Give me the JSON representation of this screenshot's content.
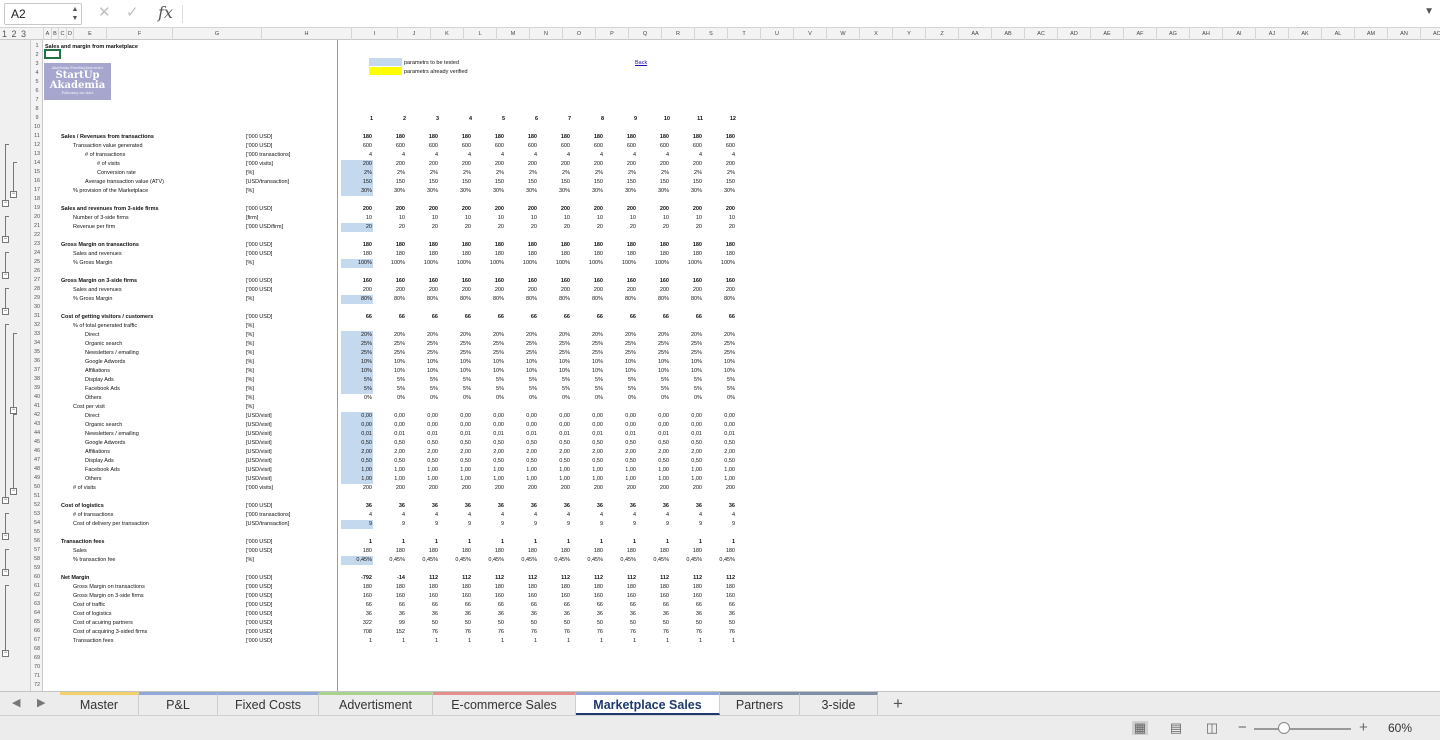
{
  "formula_bar": {
    "name_box": "A2",
    "fx_label": "fx",
    "formula": ""
  },
  "outline_levels": "1 2 3",
  "columns": [
    "A",
    "B",
    "C",
    "D",
    "E",
    "F",
    "G",
    "H",
    "I",
    "J",
    "K",
    "L",
    "M",
    "N",
    "O",
    "P",
    "Q",
    "R",
    "S",
    "T",
    "U",
    "V",
    "W",
    "X",
    "Y",
    "Z",
    "AA",
    "AB",
    "AC",
    "AD",
    "AE",
    "AF",
    "AG",
    "AH",
    "AI",
    "AJ",
    "AK",
    "AL",
    "AM",
    "AN",
    "AO"
  ],
  "sheet": {
    "title": "Sales and margin from marketplace",
    "logo_small_top": "Akademia Przedsiębiorczości",
    "logo_line1": "StartUp",
    "logo_line2": "Akademia",
    "logo_small_bottom": "Polecamy na start",
    "legend_tested": "parametrs to be tested",
    "legend_verified": "parametrs already verified",
    "back_link": "Back",
    "periods": [
      "1",
      "2",
      "3",
      "4",
      "5",
      "6",
      "7",
      "8",
      "9",
      "10",
      "11",
      "12"
    ]
  },
  "rows": [
    {
      "r": 11,
      "label": "Sales / Revenues from transactions",
      "indent": 0,
      "bold": true,
      "unit": "['000 USD]",
      "v": [
        "180",
        "180",
        "180",
        "180",
        "180",
        "180",
        "180",
        "180",
        "180",
        "180",
        "180",
        "180"
      ]
    },
    {
      "r": 12,
      "label": "Transaction value generated",
      "indent": 1,
      "unit": "['000 USD]",
      "v": [
        "600",
        "600",
        "600",
        "600",
        "600",
        "600",
        "600",
        "600",
        "600",
        "600",
        "600",
        "600"
      ]
    },
    {
      "r": 13,
      "label": "# of transactions",
      "indent": 2,
      "unit": "['000 transactions]",
      "v": [
        "4",
        "4",
        "4",
        "4",
        "4",
        "4",
        "4",
        "4",
        "4",
        "4",
        "4",
        "4"
      ]
    },
    {
      "r": 14,
      "label": "# of visits",
      "indent": 3,
      "unit": "['000 visits]",
      "hl": true,
      "v": [
        "200",
        "200",
        "200",
        "200",
        "200",
        "200",
        "200",
        "200",
        "200",
        "200",
        "200",
        "200"
      ]
    },
    {
      "r": 15,
      "label": "Conversion rate",
      "indent": 3,
      "unit": "[%]",
      "hl": true,
      "v": [
        "2%",
        "2%",
        "2%",
        "2%",
        "2%",
        "2%",
        "2%",
        "2%",
        "2%",
        "2%",
        "2%",
        "2%"
      ]
    },
    {
      "r": 16,
      "label": "Average transaction value (ATV)",
      "indent": 2,
      "unit": "[USD/transaction]",
      "hl": true,
      "v": [
        "150",
        "150",
        "150",
        "150",
        "150",
        "150",
        "150",
        "150",
        "150",
        "150",
        "150",
        "150"
      ]
    },
    {
      "r": 17,
      "label": "% provision of the Marketplace",
      "indent": 1,
      "unit": "[%]",
      "hl": true,
      "v": [
        "30%",
        "30%",
        "30%",
        "30%",
        "30%",
        "30%",
        "30%",
        "30%",
        "30%",
        "30%",
        "30%",
        "30%"
      ]
    },
    {
      "r": 19,
      "label": "Sales and revenues from 3-side firms",
      "indent": 0,
      "bold": true,
      "unit": "['000 USD]",
      "v": [
        "200",
        "200",
        "200",
        "200",
        "200",
        "200",
        "200",
        "200",
        "200",
        "200",
        "200",
        "200"
      ]
    },
    {
      "r": 20,
      "label": "Number of 3-side firms",
      "indent": 1,
      "unit": "[firm]",
      "v": [
        "10",
        "10",
        "10",
        "10",
        "10",
        "10",
        "10",
        "10",
        "10",
        "10",
        "10",
        "10"
      ]
    },
    {
      "r": 21,
      "label": "Revenue per firm",
      "indent": 1,
      "unit": "['000 USD/firm]",
      "hl": true,
      "v": [
        "20",
        "20",
        "20",
        "20",
        "20",
        "20",
        "20",
        "20",
        "20",
        "20",
        "20",
        "20"
      ]
    },
    {
      "r": 23,
      "label": "Gross Margin on transactions",
      "indent": 0,
      "bold": true,
      "unit": "['000 USD]",
      "v": [
        "180",
        "180",
        "180",
        "180",
        "180",
        "180",
        "180",
        "180",
        "180",
        "180",
        "180",
        "180"
      ]
    },
    {
      "r": 24,
      "label": "Sales and revenues",
      "indent": 1,
      "unit": "['000 USD]",
      "v": [
        "180",
        "180",
        "180",
        "180",
        "180",
        "180",
        "180",
        "180",
        "180",
        "180",
        "180",
        "180"
      ]
    },
    {
      "r": 25,
      "label": "% Gross Margin",
      "indent": 1,
      "unit": "[%]",
      "hl": true,
      "v": [
        "100%",
        "100%",
        "100%",
        "100%",
        "100%",
        "100%",
        "100%",
        "100%",
        "100%",
        "100%",
        "100%",
        "100%"
      ]
    },
    {
      "r": 27,
      "label": "Gross Margin on 3-side firms",
      "indent": 0,
      "bold": true,
      "unit": "['000 USD]",
      "v": [
        "160",
        "160",
        "160",
        "160",
        "160",
        "160",
        "160",
        "160",
        "160",
        "160",
        "160",
        "160"
      ]
    },
    {
      "r": 28,
      "label": "Sales and revenues",
      "indent": 1,
      "unit": "['000 USD]",
      "v": [
        "200",
        "200",
        "200",
        "200",
        "200",
        "200",
        "200",
        "200",
        "200",
        "200",
        "200",
        "200"
      ]
    },
    {
      "r": 29,
      "label": "% Gross Margin",
      "indent": 1,
      "unit": "[%]",
      "hl": true,
      "v": [
        "80%",
        "80%",
        "80%",
        "80%",
        "80%",
        "80%",
        "80%",
        "80%",
        "80%",
        "80%",
        "80%",
        "80%"
      ]
    },
    {
      "r": 31,
      "label": "Cost of getting visitors / customers",
      "indent": 0,
      "bold": true,
      "unit": "['000 USD]",
      "v": [
        "66",
        "66",
        "66",
        "66",
        "66",
        "66",
        "66",
        "66",
        "66",
        "66",
        "66",
        "66"
      ]
    },
    {
      "r": 32,
      "label": "% of total generated traffic",
      "indent": 1,
      "unit": "[%]",
      "v": [
        "",
        "",
        "",
        "",
        "",
        "",
        "",
        "",
        "",
        "",
        "",
        ""
      ]
    },
    {
      "r": 33,
      "label": "Direct",
      "indent": 2,
      "unit": "[%]",
      "hl": true,
      "v": [
        "20%",
        "20%",
        "20%",
        "20%",
        "20%",
        "20%",
        "20%",
        "20%",
        "20%",
        "20%",
        "20%",
        "20%"
      ]
    },
    {
      "r": 34,
      "label": "Organic search",
      "indent": 2,
      "unit": "[%]",
      "hl": true,
      "v": [
        "25%",
        "25%",
        "25%",
        "25%",
        "25%",
        "25%",
        "25%",
        "25%",
        "25%",
        "25%",
        "25%",
        "25%"
      ]
    },
    {
      "r": 35,
      "label": "Newsletters / emailing",
      "indent": 2,
      "unit": "[%]",
      "hl": true,
      "v": [
        "25%",
        "25%",
        "25%",
        "25%",
        "25%",
        "25%",
        "25%",
        "25%",
        "25%",
        "25%",
        "25%",
        "25%"
      ]
    },
    {
      "r": 36,
      "label": "Google Adwords",
      "indent": 2,
      "unit": "[%]",
      "hl": true,
      "v": [
        "10%",
        "10%",
        "10%",
        "10%",
        "10%",
        "10%",
        "10%",
        "10%",
        "10%",
        "10%",
        "10%",
        "10%"
      ]
    },
    {
      "r": 37,
      "label": "Affiliations",
      "indent": 2,
      "unit": "[%]",
      "hl": true,
      "v": [
        "10%",
        "10%",
        "10%",
        "10%",
        "10%",
        "10%",
        "10%",
        "10%",
        "10%",
        "10%",
        "10%",
        "10%"
      ]
    },
    {
      "r": 38,
      "label": "Display Ads",
      "indent": 2,
      "unit": "[%]",
      "hl": true,
      "v": [
        "5%",
        "5%",
        "5%",
        "5%",
        "5%",
        "5%",
        "5%",
        "5%",
        "5%",
        "5%",
        "5%",
        "5%"
      ]
    },
    {
      "r": 39,
      "label": "Facebook Ads",
      "indent": 2,
      "unit": "[%]",
      "hl": true,
      "v": [
        "5%",
        "5%",
        "5%",
        "5%",
        "5%",
        "5%",
        "5%",
        "5%",
        "5%",
        "5%",
        "5%",
        "5%"
      ]
    },
    {
      "r": 40,
      "label": "Others",
      "indent": 2,
      "unit": "[%]",
      "v": [
        "0%",
        "0%",
        "0%",
        "0%",
        "0%",
        "0%",
        "0%",
        "0%",
        "0%",
        "0%",
        "0%",
        "0%"
      ]
    },
    {
      "r": 41,
      "label": "Cost per visit",
      "indent": 1,
      "unit": "[%]",
      "v": [
        "",
        "",
        "",
        "",
        "",
        "",
        "",
        "",
        "",
        "",
        "",
        ""
      ]
    },
    {
      "r": 42,
      "label": "Direct",
      "indent": 2,
      "unit": "[USD/visit]",
      "hl": true,
      "v": [
        "0,00",
        "0,00",
        "0,00",
        "0,00",
        "0,00",
        "0,00",
        "0,00",
        "0,00",
        "0,00",
        "0,00",
        "0,00",
        "0,00"
      ]
    },
    {
      "r": 43,
      "label": "Organic search",
      "indent": 2,
      "unit": "[USD/visit]",
      "hl": true,
      "v": [
        "0,00",
        "0,00",
        "0,00",
        "0,00",
        "0,00",
        "0,00",
        "0,00",
        "0,00",
        "0,00",
        "0,00",
        "0,00",
        "0,00"
      ]
    },
    {
      "r": 44,
      "label": "Newsletters / emailing",
      "indent": 2,
      "unit": "[USD/visit]",
      "hl": true,
      "v": [
        "0,01",
        "0,01",
        "0,01",
        "0,01",
        "0,01",
        "0,01",
        "0,01",
        "0,01",
        "0,01",
        "0,01",
        "0,01",
        "0,01"
      ]
    },
    {
      "r": 45,
      "label": "Google Adwords",
      "indent": 2,
      "unit": "[USD/visit]",
      "hl": true,
      "v": [
        "0,50",
        "0,50",
        "0,50",
        "0,50",
        "0,50",
        "0,50",
        "0,50",
        "0,50",
        "0,50",
        "0,50",
        "0,50",
        "0,50"
      ]
    },
    {
      "r": 46,
      "label": "Affiliations",
      "indent": 2,
      "unit": "[USD/visit]",
      "hl": true,
      "v": [
        "2,00",
        "2,00",
        "2,00",
        "2,00",
        "2,00",
        "2,00",
        "2,00",
        "2,00",
        "2,00",
        "2,00",
        "2,00",
        "2,00"
      ]
    },
    {
      "r": 47,
      "label": "Display Ads",
      "indent": 2,
      "unit": "[USD/visit]",
      "hl": true,
      "v": [
        "0,50",
        "0,50",
        "0,50",
        "0,50",
        "0,50",
        "0,50",
        "0,50",
        "0,50",
        "0,50",
        "0,50",
        "0,50",
        "0,50"
      ]
    },
    {
      "r": 48,
      "label": "Facebook Ads",
      "indent": 2,
      "unit": "[USD/visit]",
      "hl": true,
      "v": [
        "1,00",
        "1,00",
        "1,00",
        "1,00",
        "1,00",
        "1,00",
        "1,00",
        "1,00",
        "1,00",
        "1,00",
        "1,00",
        "1,00"
      ]
    },
    {
      "r": 49,
      "label": "Others",
      "indent": 2,
      "unit": "[USD/visit]",
      "hl": true,
      "v": [
        "1,00",
        "1,00",
        "1,00",
        "1,00",
        "1,00",
        "1,00",
        "1,00",
        "1,00",
        "1,00",
        "1,00",
        "1,00",
        "1,00"
      ]
    },
    {
      "r": 50,
      "label": "# of visits",
      "indent": 1,
      "unit": "['000 visits]",
      "v": [
        "200",
        "200",
        "200",
        "200",
        "200",
        "200",
        "200",
        "200",
        "200",
        "200",
        "200",
        "200"
      ]
    },
    {
      "r": 52,
      "label": "Cost of logistics",
      "indent": 0,
      "bold": true,
      "unit": "['000 USD]",
      "v": [
        "36",
        "36",
        "36",
        "36",
        "36",
        "36",
        "36",
        "36",
        "36",
        "36",
        "36",
        "36"
      ]
    },
    {
      "r": 53,
      "label": "# of transactions",
      "indent": 1,
      "unit": "['000 transactions]",
      "v": [
        "4",
        "4",
        "4",
        "4",
        "4",
        "4",
        "4",
        "4",
        "4",
        "4",
        "4",
        "4"
      ]
    },
    {
      "r": 54,
      "label": "Cost of delivery per transaction",
      "indent": 1,
      "unit": "[USD/transaction]",
      "hl": true,
      "v": [
        "9",
        "9",
        "9",
        "9",
        "9",
        "9",
        "9",
        "9",
        "9",
        "9",
        "9",
        "9"
      ]
    },
    {
      "r": 56,
      "label": "Transaction fees",
      "indent": 0,
      "bold": true,
      "unit": "['000 USD]",
      "v": [
        "1",
        "1",
        "1",
        "1",
        "1",
        "1",
        "1",
        "1",
        "1",
        "1",
        "1",
        "1"
      ]
    },
    {
      "r": 57,
      "label": "Sales",
      "indent": 1,
      "unit": "['000 USD]",
      "v": [
        "180",
        "180",
        "180",
        "180",
        "180",
        "180",
        "180",
        "180",
        "180",
        "180",
        "180",
        "180"
      ]
    },
    {
      "r": 58,
      "label": "% transaction fee",
      "indent": 1,
      "unit": "[%]",
      "hl": true,
      "v": [
        "0,45%",
        "0,45%",
        "0,45%",
        "0,45%",
        "0,45%",
        "0,45%",
        "0,45%",
        "0,45%",
        "0,45%",
        "0,45%",
        "0,45%",
        "0,45%"
      ]
    },
    {
      "r": 60,
      "label": "Net Margin",
      "indent": 0,
      "bold": true,
      "unit": "['000 USD]",
      "v": [
        "-792",
        "-14",
        "112",
        "112",
        "112",
        "112",
        "112",
        "112",
        "112",
        "112",
        "112",
        "112"
      ]
    },
    {
      "r": 61,
      "label": "Gross Margin on transactions",
      "indent": 1,
      "unit": "['000 USD]",
      "v": [
        "180",
        "180",
        "180",
        "180",
        "180",
        "180",
        "180",
        "180",
        "180",
        "180",
        "180",
        "180"
      ]
    },
    {
      "r": 62,
      "label": "Gross Margin on 3-side firms",
      "indent": 1,
      "unit": "['000 USD]",
      "v": [
        "160",
        "160",
        "160",
        "160",
        "160",
        "160",
        "160",
        "160",
        "160",
        "160",
        "160",
        "160"
      ]
    },
    {
      "r": 63,
      "label": "Cost of traffic",
      "indent": 1,
      "unit": "['000 USD]",
      "v": [
        "66",
        "66",
        "66",
        "66",
        "66",
        "66",
        "66",
        "66",
        "66",
        "66",
        "66",
        "66"
      ]
    },
    {
      "r": 64,
      "label": "Cost of logistics",
      "indent": 1,
      "unit": "['000 USD]",
      "v": [
        "36",
        "36",
        "36",
        "36",
        "36",
        "36",
        "36",
        "36",
        "36",
        "36",
        "36",
        "36"
      ]
    },
    {
      "r": 65,
      "label": "Cost of acuiring partners",
      "indent": 1,
      "unit": "['000 USD]",
      "v": [
        "322",
        "99",
        "50",
        "50",
        "50",
        "50",
        "50",
        "50",
        "50",
        "50",
        "50",
        "50"
      ]
    },
    {
      "r": 66,
      "label": "Cost of acquiring 3-sided firms",
      "indent": 1,
      "unit": "['000 USD]",
      "v": [
        "708",
        "152",
        "76",
        "76",
        "76",
        "76",
        "76",
        "76",
        "76",
        "76",
        "76",
        "76"
      ]
    },
    {
      "r": 67,
      "label": "Transaction fees",
      "indent": 1,
      "unit": "['000 USD]",
      "v": [
        "1",
        "1",
        "1",
        "1",
        "1",
        "1",
        "1",
        "1",
        "1",
        "1",
        "1",
        "1"
      ]
    }
  ],
  "tabs": [
    {
      "label": "Master",
      "color": "#f2d16b",
      "active": false
    },
    {
      "label": "P&L",
      "color": "#8fa8d6",
      "active": false
    },
    {
      "label": "Fixed Costs",
      "color": "#8fa8d6",
      "active": false
    },
    {
      "label": "Advertisment",
      "color": "#a9d18e",
      "active": false
    },
    {
      "label": "E-commerce Sales",
      "color": "#e58e8e",
      "active": false
    },
    {
      "label": "Marketplace Sales",
      "color": "#8fa8d6",
      "active": true
    },
    {
      "label": "Partners",
      "color": "#7f8fa6",
      "active": false
    },
    {
      "label": "3-side",
      "color": "#7f8fa6",
      "active": false
    }
  ],
  "add_sheet": "+",
  "status": {
    "zoom": "60%",
    "zoom_minus": "−",
    "zoom_plus": "+"
  }
}
